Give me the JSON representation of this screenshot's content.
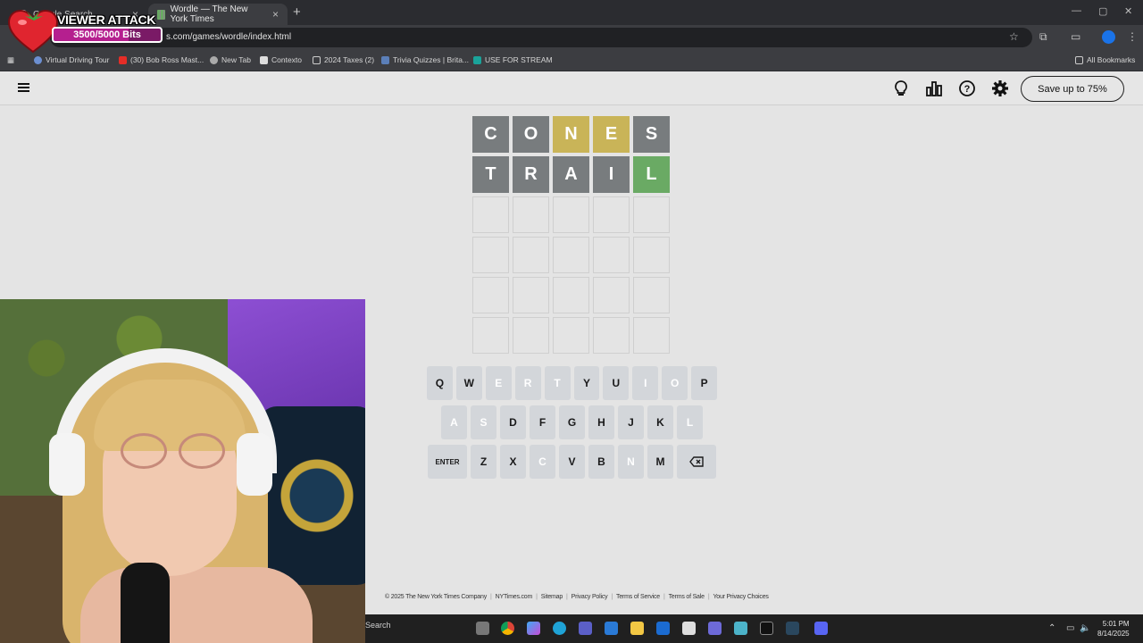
{
  "browser": {
    "tabs": [
      {
        "title": "Google Search",
        "active": false
      },
      {
        "title": "Wordle — The New York Times",
        "active": true
      }
    ],
    "url": "s.com/games/wordle/index.html",
    "bookmarks": [
      "Virtual Driving Tour",
      "(30) Bob Ross Mast...",
      "New Tab",
      "Contexto",
      "2024 Taxes (2)",
      "Trivia Quizzes | Brita...",
      "USE FOR STREAM"
    ],
    "all_bookmarks": "All Bookmarks"
  },
  "overlay": {
    "title": "VIEWER ATTACK",
    "bits": "3500/5000 Bits",
    "progress": 0.7
  },
  "header": {
    "save_button": "Save up to 75%"
  },
  "board": {
    "rows": [
      [
        {
          "l": "C",
          "s": "absent"
        },
        {
          "l": "O",
          "s": "absent"
        },
        {
          "l": "N",
          "s": "present"
        },
        {
          "l": "E",
          "s": "present"
        },
        {
          "l": "S",
          "s": "absent"
        }
      ],
      [
        {
          "l": "T",
          "s": "absent"
        },
        {
          "l": "R",
          "s": "absent"
        },
        {
          "l": "A",
          "s": "absent"
        },
        {
          "l": "I",
          "s": "absent"
        },
        {
          "l": "L",
          "s": "correct"
        }
      ],
      [
        {
          "l": "",
          "s": "empty"
        },
        {
          "l": "",
          "s": "empty"
        },
        {
          "l": "",
          "s": "empty"
        },
        {
          "l": "",
          "s": "empty"
        },
        {
          "l": "",
          "s": "empty"
        }
      ],
      [
        {
          "l": "",
          "s": "empty"
        },
        {
          "l": "",
          "s": "empty"
        },
        {
          "l": "",
          "s": "empty"
        },
        {
          "l": "",
          "s": "empty"
        },
        {
          "l": "",
          "s": "empty"
        }
      ],
      [
        {
          "l": "",
          "s": "empty"
        },
        {
          "l": "",
          "s": "empty"
        },
        {
          "l": "",
          "s": "empty"
        },
        {
          "l": "",
          "s": "empty"
        },
        {
          "l": "",
          "s": "empty"
        }
      ],
      [
        {
          "l": "",
          "s": "empty"
        },
        {
          "l": "",
          "s": "empty"
        },
        {
          "l": "",
          "s": "empty"
        },
        {
          "l": "",
          "s": "empty"
        },
        {
          "l": "",
          "s": "empty"
        }
      ]
    ]
  },
  "keyboard": {
    "rows": [
      [
        {
          "k": "Q",
          "s": ""
        },
        {
          "k": "W",
          "s": ""
        },
        {
          "k": "E",
          "s": "present"
        },
        {
          "k": "R",
          "s": "absent"
        },
        {
          "k": "T",
          "s": "absent"
        },
        {
          "k": "Y",
          "s": ""
        },
        {
          "k": "U",
          "s": ""
        },
        {
          "k": "I",
          "s": "absent"
        },
        {
          "k": "O",
          "s": "absent"
        },
        {
          "k": "P",
          "s": ""
        }
      ],
      [
        {
          "k": "A",
          "s": "absent"
        },
        {
          "k": "S",
          "s": "absent"
        },
        {
          "k": "D",
          "s": ""
        },
        {
          "k": "F",
          "s": ""
        },
        {
          "k": "G",
          "s": ""
        },
        {
          "k": "H",
          "s": ""
        },
        {
          "k": "J",
          "s": ""
        },
        {
          "k": "K",
          "s": ""
        },
        {
          "k": "L",
          "s": "correct"
        }
      ],
      [
        {
          "k": "ENTER",
          "s": "",
          "wide": true
        },
        {
          "k": "Z",
          "s": ""
        },
        {
          "k": "X",
          "s": ""
        },
        {
          "k": "C",
          "s": "absent"
        },
        {
          "k": "V",
          "s": ""
        },
        {
          "k": "B",
          "s": ""
        },
        {
          "k": "N",
          "s": "present"
        },
        {
          "k": "M",
          "s": ""
        },
        {
          "k": "⌫",
          "s": "",
          "wide": true,
          "name": "backspace"
        }
      ]
    ]
  },
  "footer": {
    "links": [
      "© 2025 The New York Times Company",
      "NYTimes.com",
      "Sitemap",
      "Privacy Policy",
      "Terms of Service",
      "Terms of Sale",
      "Your Privacy Choices"
    ]
  },
  "taskbar": {
    "search": "Search",
    "time": "5:01 PM",
    "date": "8/14/2025"
  },
  "colors": {
    "absent": "#787c7e",
    "present": "#c9b458",
    "correct": "#6aaa64",
    "key_default": "#d3d6da",
    "overlay_bar": "#b51f8f"
  },
  "icons": [
    "hamburger-icon",
    "hint-bulb-icon",
    "stats-icon",
    "help-icon",
    "settings-gear-icon",
    "backspace-icon"
  ]
}
